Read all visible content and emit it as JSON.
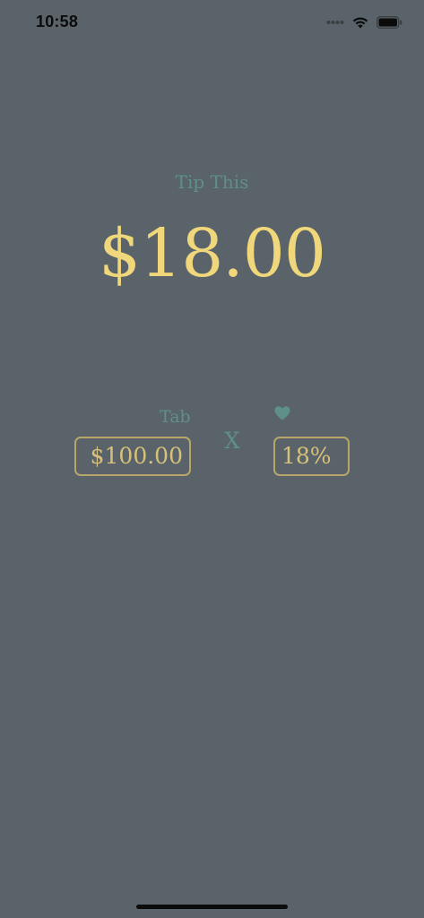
{
  "status_bar": {
    "time": "10:58",
    "icons": [
      "signal-dots-icon",
      "wifi-icon",
      "battery-icon"
    ]
  },
  "main": {
    "title": "Tip This",
    "tip_amount": "$18.00"
  },
  "inputs": {
    "tab_label": "Tab",
    "tab_value": "$100.00",
    "operator": "X",
    "percent_icon": "heart-icon",
    "percent_value": "18%"
  },
  "colors": {
    "background": "#596369",
    "accent_gold": "#f1d77b",
    "label_teal": "#5f9088",
    "field_border": "#b6a66a"
  }
}
